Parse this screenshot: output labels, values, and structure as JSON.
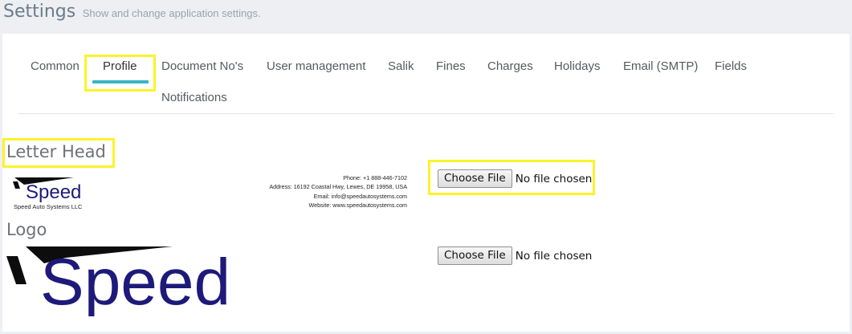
{
  "header": {
    "title": "Settings",
    "subtitle": "Show and change application settings."
  },
  "tabs": [
    {
      "label": "Common"
    },
    {
      "label": "Profile"
    },
    {
      "label": "Document No's"
    },
    {
      "label": "User management"
    },
    {
      "label": "Salik"
    },
    {
      "label": "Fines"
    },
    {
      "label": "Charges"
    },
    {
      "label": "Holidays"
    },
    {
      "label": "Email (SMTP)"
    },
    {
      "label": "Fields"
    },
    {
      "label": "Notifications"
    }
  ],
  "active_tab": "Profile",
  "letter_head": {
    "title": "Letter Head",
    "logo_text": "Speed",
    "company": "Speed Auto Systems LLC",
    "phone": "Phone: +1 888-446-7102",
    "address": "Address: 16192 Coastal Hwy, Lewes, DE 19958, USA",
    "email": "Email: info@speedautosystems.com",
    "website": "Website: www.speedautosystems.com",
    "file_button": "Choose File",
    "file_status": "No file chosen"
  },
  "logo": {
    "title": "Logo",
    "logo_text": "Speed",
    "file_button": "Choose File",
    "file_status": "No file chosen"
  },
  "colors": {
    "accent": "#36b6c4",
    "highlight": "#fbf32a",
    "brand": "#1d1a7a"
  }
}
